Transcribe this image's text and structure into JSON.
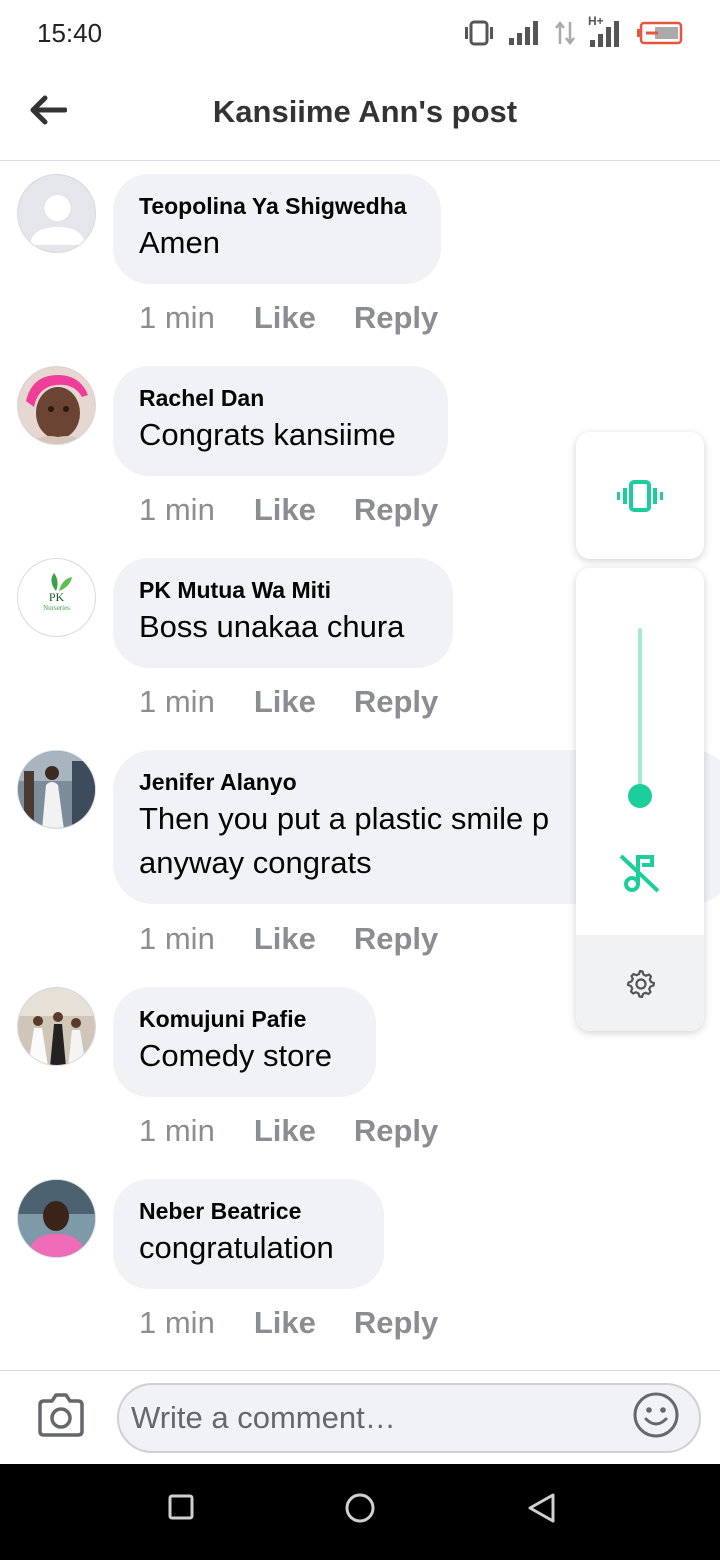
{
  "status_bar": {
    "time": "15:40",
    "network_label": "H+"
  },
  "header": {
    "title": "Kansiime Ann's post"
  },
  "comments": [
    {
      "name": "Teopolina Ya Shigwedha",
      "text_lines": [
        "Amen"
      ],
      "time": "1 min",
      "like": "Like",
      "reply": "Reply"
    },
    {
      "name": "Rachel Dan",
      "text_lines": [
        "Congrats kansiime"
      ],
      "time": "1 min",
      "like": "Like",
      "reply": "Reply"
    },
    {
      "name": "PK Mutua Wa Miti",
      "text_lines": [
        "Boss unakaa chura"
      ],
      "time": "1 min",
      "like": "Like",
      "reply": "Reply",
      "avatar_logo_text": "PK",
      "avatar_logo_sub": "Nurseries"
    },
    {
      "name": "Jenifer Alanyo",
      "text_lines": [
        "Then you put a plastic smile p",
        "anyway congrats"
      ],
      "time": "1 min",
      "like": "Like",
      "reply": "Reply"
    },
    {
      "name": "Komujuni Pafie",
      "text_lines": [
        "Comedy store"
      ],
      "time": "1 min",
      "like": "Like",
      "reply": "Reply"
    },
    {
      "name": "Neber Beatrice",
      "text_lines": [
        "congratulation"
      ],
      "time": "1 min",
      "like": "Like",
      "reply": "Reply"
    }
  ],
  "composer": {
    "placeholder": "Write a comment…",
    "value": ""
  },
  "volume_panel": {
    "accent_color": "#1ccf9a",
    "level": 0.0,
    "mode": "vibrate"
  },
  "icons": {
    "back": "back-arrow-icon",
    "camera": "camera-icon",
    "emoji": "emoji-icon",
    "vibrate": "vibrate-icon",
    "mute": "music-note-off-icon",
    "settings": "gear-icon"
  }
}
